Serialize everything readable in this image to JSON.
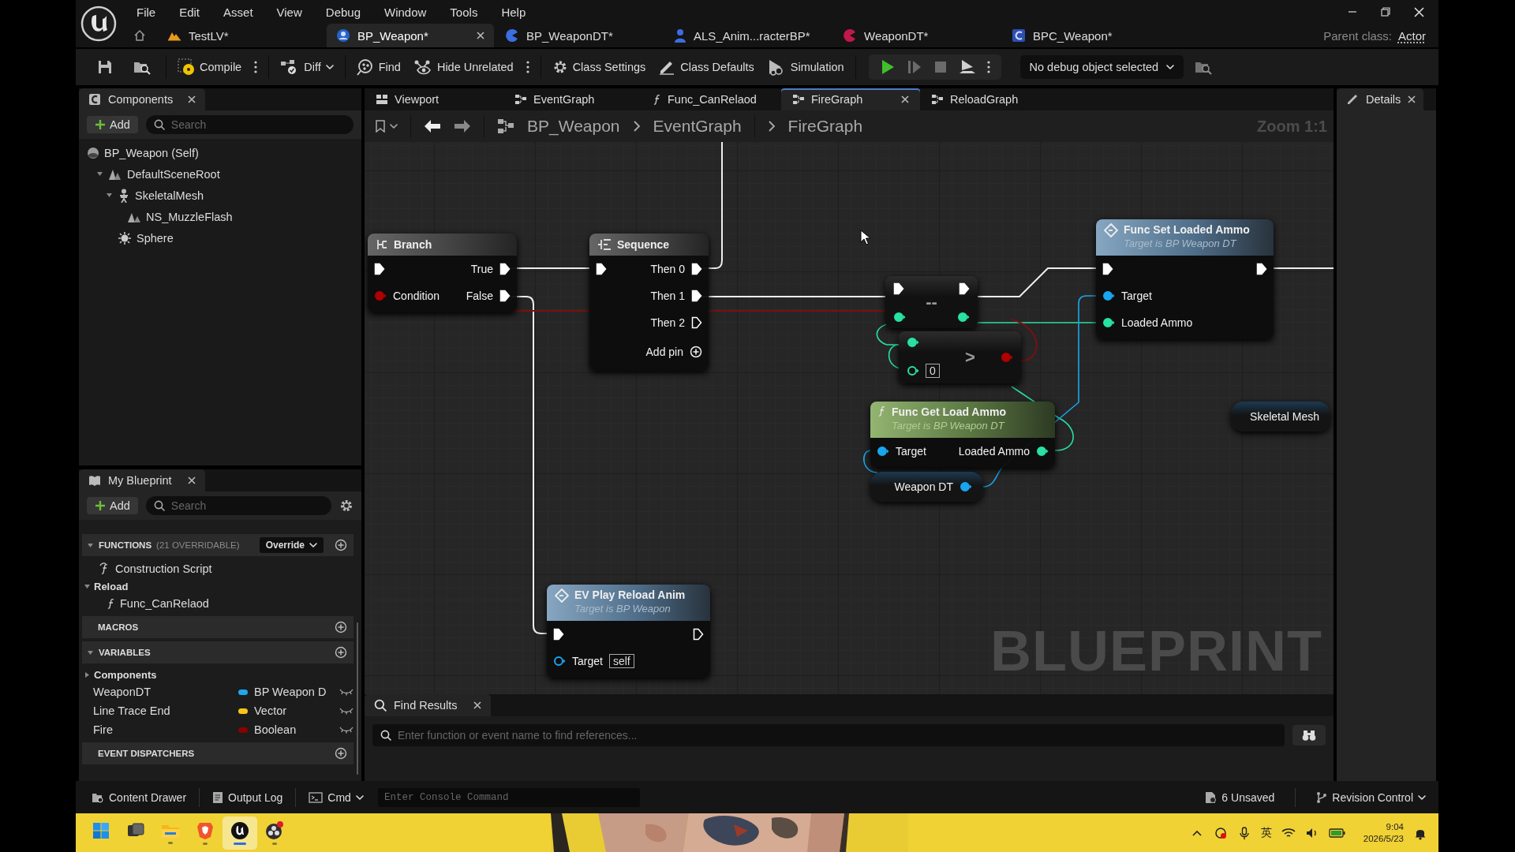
{
  "menu": [
    "File",
    "Edit",
    "Asset",
    "View",
    "Debug",
    "Window",
    "Tools",
    "Help"
  ],
  "asset_tabs": [
    {
      "label": "TestLV*",
      "kind": "level",
      "selected": false
    },
    {
      "label": "BP_Weapon*",
      "kind": "actor",
      "selected": true
    },
    {
      "label": "BP_WeaponDT*",
      "kind": "struct",
      "selected": false
    },
    {
      "label": "ALS_Anim...racterBP*",
      "kind": "character",
      "selected": false
    },
    {
      "label": "WeaponDT*",
      "kind": "table",
      "selected": false
    },
    {
      "label": "BPC_Weapon*",
      "kind": "component",
      "selected": false
    }
  ],
  "parent_class": {
    "label": "Parent class:",
    "value": "Actor"
  },
  "toolbar": [
    {
      "kind": "save"
    },
    {
      "kind": "browse"
    },
    {
      "kind": "sep"
    },
    {
      "kind": "compile",
      "label": "Compile"
    },
    {
      "kind": "kebab"
    },
    {
      "kind": "sep"
    },
    {
      "kind": "diff",
      "label": "Diff"
    },
    {
      "kind": "sep"
    },
    {
      "kind": "find",
      "label": "Find"
    },
    {
      "kind": "hide",
      "label": "Hide Unrelated"
    },
    {
      "kind": "kebab"
    },
    {
      "kind": "sep"
    },
    {
      "kind": "settings",
      "label": "Class Settings"
    },
    {
      "kind": "defaults",
      "label": "Class Defaults"
    },
    {
      "kind": "simulation",
      "label": "Simulation"
    }
  ],
  "play_controls": [
    {
      "kind": "play",
      "disabled": false
    },
    {
      "kind": "resume",
      "disabled": true
    },
    {
      "kind": "stop",
      "disabled": true
    },
    {
      "kind": "eject",
      "disabled": false
    },
    {
      "kind": "kebab"
    }
  ],
  "debug_object": {
    "value": "No debug object selected"
  },
  "components_panel": {
    "title": "Components",
    "add": "Add",
    "search": {
      "placeholder": "Search"
    },
    "tree": [
      {
        "label": "BP_Weapon (Self)",
        "kind": "self",
        "children": [
          {
            "label": "DefaultSceneRoot",
            "kind": "scene",
            "expanded": true,
            "children": [
              {
                "label": "SkeletalMesh",
                "kind": "skeleton",
                "expanded": true,
                "children": [
                  {
                    "label": "NS_MuzzleFlash",
                    "kind": "niagara"
                  }
                ]
              },
              {
                "label": "Sphere",
                "kind": "sphere"
              }
            ]
          }
        ]
      }
    ]
  },
  "my_blueprint": {
    "title": "My Blueprint",
    "add": "Add",
    "search": {
      "placeholder": "Search"
    },
    "sections": [
      {
        "title": "FUNCTIONS",
        "note": "(21 OVERRIDABLE)",
        "override": "Override",
        "expanded": true,
        "items": [
          {
            "kind": "construction",
            "label": "Construction Script"
          },
          {
            "kind": "category",
            "label": "Reload",
            "expanded": true,
            "children": [
              {
                "kind": "function",
                "label": "Func_CanRelaod"
              }
            ]
          }
        ]
      },
      {
        "title": "MACROS"
      },
      {
        "title": "VARIABLES",
        "expanded": true,
        "items": [
          {
            "kind": "category",
            "label": "Components",
            "expanded": false
          },
          {
            "kind": "variable",
            "label": "WeaponDT",
            "type": "BP Weapon D",
            "color": "#1ea7f0"
          },
          {
            "kind": "variable",
            "label": "Line Trace End",
            "type": "Vector",
            "color": "#f5c518"
          },
          {
            "kind": "variable",
            "label": "Fire",
            "type": "Boolean",
            "color": "#8a0000"
          }
        ]
      },
      {
        "title": "EVENT DISPATCHERS"
      }
    ]
  },
  "graph_tabs": [
    {
      "label": "Viewport",
      "kind": "viewport",
      "selected": false
    },
    {
      "label": "EventGraph",
      "kind": "graph",
      "selected": false
    },
    {
      "label": "Func_CanRelaod",
      "kind": "function",
      "selected": false
    },
    {
      "label": "FireGraph",
      "kind": "graph",
      "selected": true
    },
    {
      "label": "ReloadGraph",
      "kind": "graph",
      "selected": false
    }
  ],
  "breadcrumb": [
    "BP_Weapon",
    "EventGraph",
    "FireGraph"
  ],
  "zoom": "Zoom 1:1",
  "graph": {
    "watermark": "BLUEPRINT",
    "nodes": [
      {
        "kind": "branch",
        "title": "Branch",
        "rows": [
          {
            "left": {
              "kind": "exec",
              "connected": true
            },
            "right": {
              "kind": "exec",
              "label": "True",
              "connected": true
            }
          },
          {
            "left": {
              "kind": "bool",
              "label": "Condition",
              "connected": true
            },
            "right": {
              "kind": "exec",
              "label": "False",
              "connected": true
            }
          }
        ]
      },
      {
        "kind": "sequence",
        "title": "Sequence",
        "add_pin": "Add pin",
        "rows": [
          {
            "left": {
              "kind": "exec",
              "connected": true
            },
            "right": {
              "kind": "exec",
              "label": "Then 0",
              "connected": true
            }
          },
          {
            "right": {
              "kind": "exec",
              "label": "Then 1",
              "connected": true
            }
          },
          {
            "right": {
              "kind": "exec",
              "label": "Then 2",
              "connected": false
            }
          }
        ]
      },
      {
        "kind": "compact",
        "title": "--",
        "rows": [
          {
            "left": {
              "kind": "exec",
              "connected": true
            },
            "right": {
              "kind": "exec",
              "connected": true
            }
          },
          {
            "left": {
              "kind": "int",
              "connected": true
            },
            "right": {
              "kind": "int",
              "connected": true
            }
          }
        ]
      },
      {
        "kind": "compact",
        "title": ">",
        "rows": [
          {
            "left": {
              "kind": "int",
              "connected": true
            }
          },
          {
            "left": {
              "kind": "int",
              "connected": false,
              "default": "0"
            },
            "right": {
              "kind": "bool",
              "connected": true
            }
          }
        ]
      },
      {
        "kind": "function",
        "title": "Func Get Load Ammo",
        "subtitle": "Target is BP Weapon DT",
        "rows": [
          {
            "left": {
              "kind": "object",
              "label": "Target",
              "connected": true
            },
            "right": {
              "kind": "int",
              "label": "Loaded Ammo",
              "connected": true
            }
          }
        ]
      },
      {
        "kind": "getter",
        "title": "Weapon DT",
        "out": {
          "kind": "object",
          "connected": true
        }
      },
      {
        "kind": "call",
        "title": "Func Set Loaded Ammo",
        "subtitle": "Target is BP Weapon DT",
        "rows": [
          {
            "left": {
              "kind": "exec",
              "connected": true
            },
            "right": {
              "kind": "exec",
              "connected": true
            }
          },
          {
            "left": {
              "kind": "object",
              "label": "Target",
              "connected": true
            }
          },
          {
            "left": {
              "kind": "int",
              "label": "Loaded Ammo",
              "connected": true
            }
          }
        ]
      },
      {
        "kind": "getter",
        "title": "Skeletal Mesh"
      },
      {
        "kind": "call",
        "title": "EV Play Reload Anim",
        "subtitle": "Target is BP Weapon",
        "rows": [
          {
            "left": {
              "kind": "exec",
              "connected": true
            },
            "right": {
              "kind": "exec",
              "connected": false
            }
          },
          {
            "left": {
              "kind": "object",
              "label": "Target",
              "connected": false,
              "default": "self"
            }
          }
        ]
      }
    ]
  },
  "find_results": {
    "title": "Find Results",
    "search": {
      "placeholder": "Enter function or event name to find references..."
    }
  },
  "details": {
    "title": "Details"
  },
  "status_bar": {
    "left": [
      {
        "kind": "drawer",
        "label": "Content Drawer"
      },
      {
        "kind": "log",
        "label": "Output Log"
      },
      {
        "kind": "cmd",
        "label": "Cmd"
      }
    ],
    "console": {
      "placeholder": "Enter Console Command"
    },
    "right": [
      {
        "kind": "unsaved",
        "label": "6 Unsaved"
      },
      {
        "kind": "revision",
        "label": "Revision Control"
      }
    ]
  },
  "taskbar": {
    "apps": [
      {
        "kind": "start",
        "running": false,
        "active": false
      },
      {
        "kind": "taskview",
        "running": false,
        "active": false
      },
      {
        "kind": "explorer",
        "running": true,
        "active": false
      },
      {
        "kind": "browser",
        "running": true,
        "active": false
      },
      {
        "kind": "unreal",
        "running": true,
        "active": true
      },
      {
        "kind": "recorder",
        "running": true,
        "active": false
      }
    ],
    "tray": {
      "ime": "英",
      "time": "9:04",
      "date": "2026/5/23"
    }
  }
}
